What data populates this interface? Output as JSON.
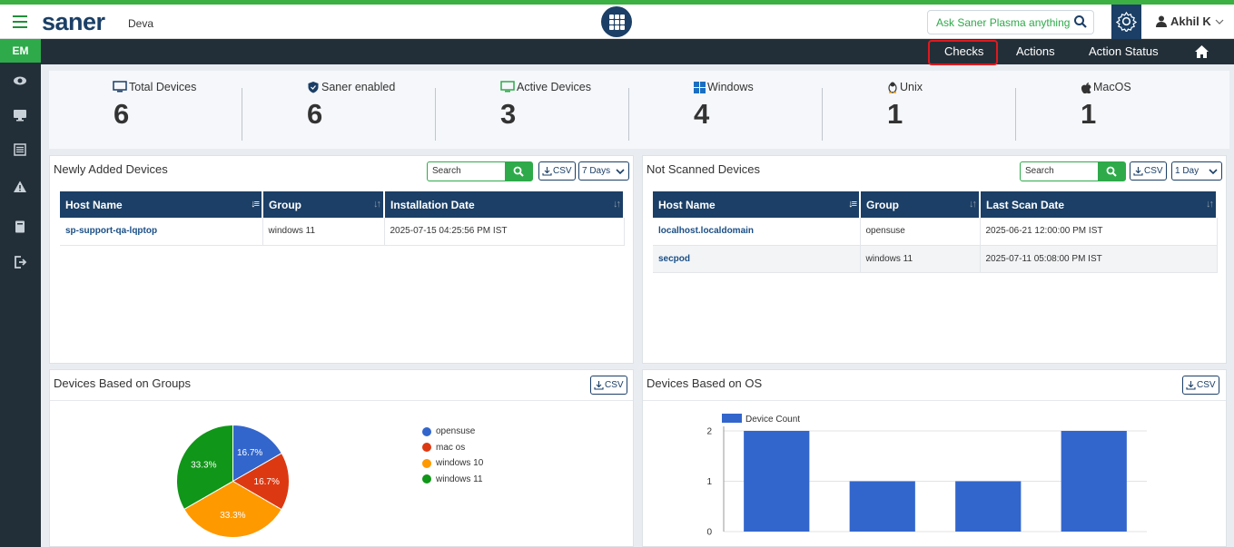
{
  "header": {
    "logo": "saner",
    "org": "Deva",
    "ask_placeholder": "Ask Saner Plasma anything !",
    "user": "Akhil K"
  },
  "nav": {
    "checks": "Checks",
    "actions": "Actions",
    "action_status": "Action Status"
  },
  "sidebar": {
    "badge": "EM"
  },
  "stats": [
    {
      "label": "Total Devices",
      "value": "6",
      "icon": "monitor-icon"
    },
    {
      "label": "Saner enabled",
      "value": "6",
      "icon": "shield-icon"
    },
    {
      "label": "Active Devices",
      "value": "3",
      "icon": "monitor-icon"
    },
    {
      "label": "Windows",
      "value": "4",
      "icon": "windows-icon"
    },
    {
      "label": "Unix",
      "value": "1",
      "icon": "linux-icon"
    },
    {
      "label": "MacOS",
      "value": "1",
      "icon": "apple-icon"
    }
  ],
  "newly_added": {
    "title": "Newly Added Devices",
    "search_placeholder": "Search",
    "csv": "CSV",
    "range": "7 Days",
    "columns": [
      "Host Name",
      "Group",
      "Installation Date"
    ],
    "rows": [
      [
        "sp-support-qa-lqptop",
        "windows 11",
        "2025-07-15 04:25:56 PM IST"
      ]
    ]
  },
  "not_scanned": {
    "title": "Not Scanned Devices",
    "search_placeholder": "Search",
    "csv": "CSV",
    "range": "1 Day",
    "columns": [
      "Host Name",
      "Group",
      "Last Scan Date"
    ],
    "rows": [
      [
        "localhost.localdomain",
        "opensuse",
        "2025-06-21 12:00:00 PM IST"
      ],
      [
        "secpod",
        "windows 11",
        "2025-07-11 05:08:00 PM IST"
      ]
    ]
  },
  "groups_panel": {
    "title": "Devices Based on Groups",
    "csv": "CSV"
  },
  "os_panel": {
    "title": "Devices Based on OS",
    "csv": "CSV"
  },
  "colors": {
    "navy": "#1b3f66",
    "green": "#2eaa4a",
    "highlight": "#e0191f"
  },
  "chart_data": [
    {
      "type": "pie",
      "labels": [
        "opensuse",
        "mac os",
        "windows 10",
        "windows 11"
      ],
      "values": [
        16.7,
        16.7,
        33.3,
        33.3
      ],
      "slice_labels": [
        "16.7%",
        "16.7%",
        "33.3%",
        "33.3%"
      ],
      "colors": [
        "#3366cc",
        "#dc3912",
        "#ff9900",
        "#109618"
      ],
      "legend": "right"
    },
    {
      "type": "bar",
      "series": [
        {
          "name": "Device Count",
          "values": [
            2,
            1,
            1,
            2
          ]
        }
      ],
      "yticks": [
        "0",
        "1",
        "2"
      ],
      "ylim": [
        0,
        2
      ],
      "legend": "top-left",
      "color": "#3366cc"
    }
  ]
}
